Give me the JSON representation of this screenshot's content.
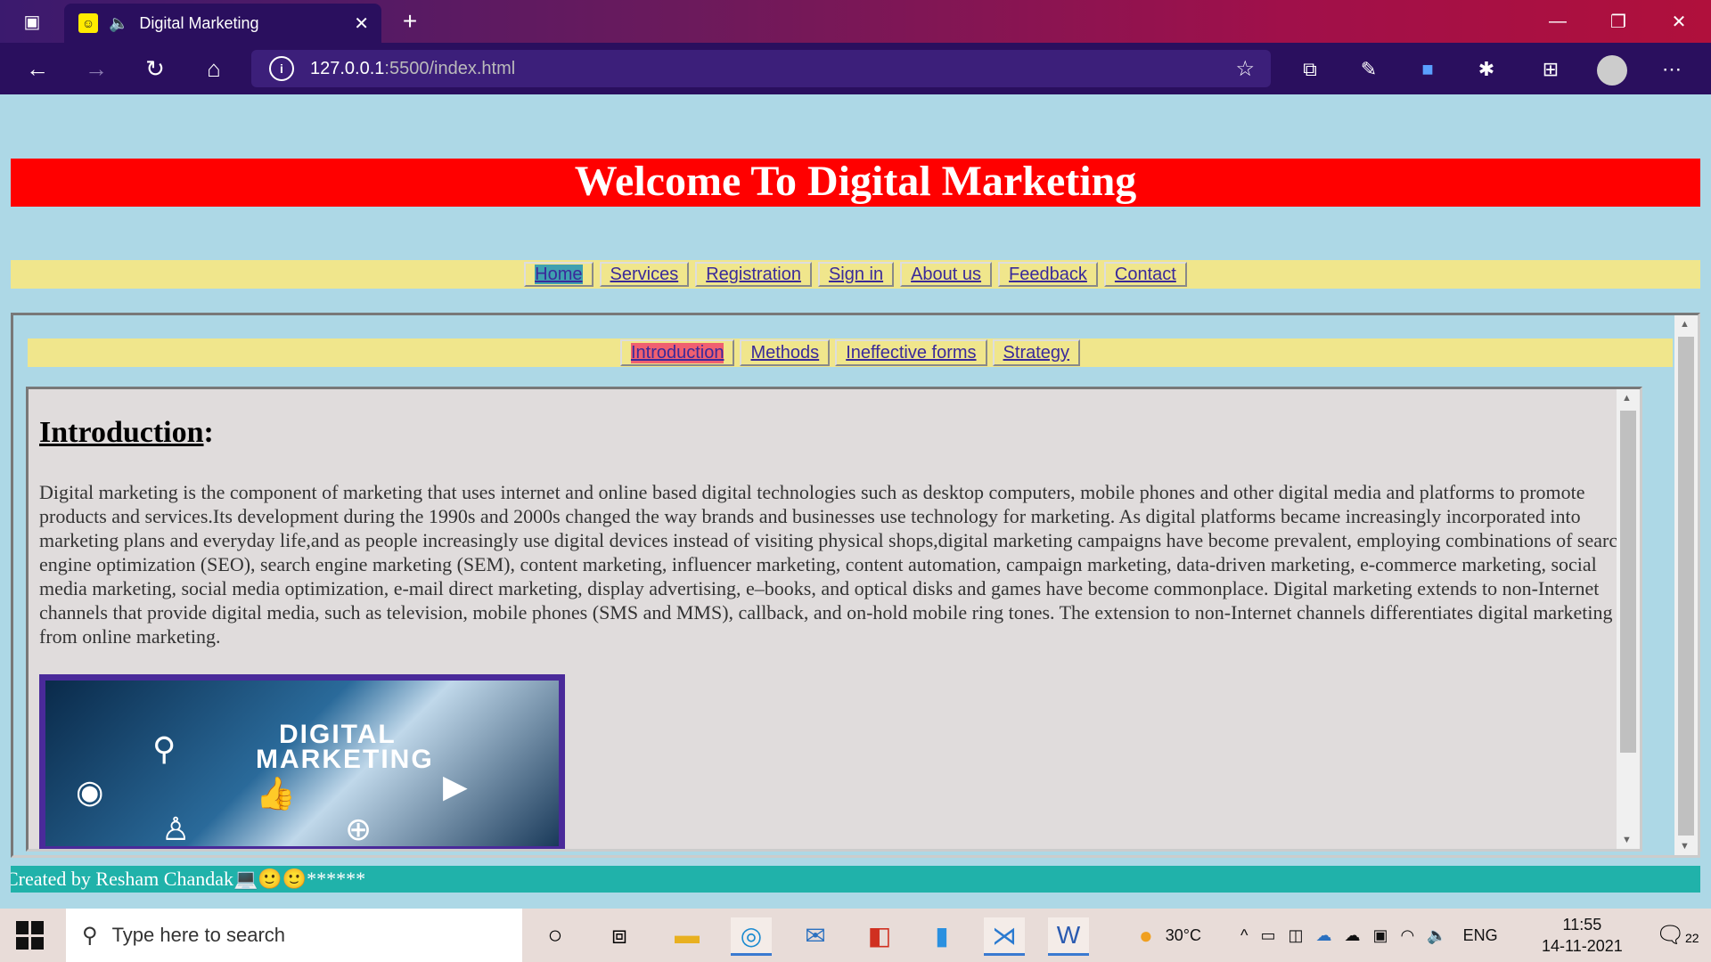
{
  "browser": {
    "tab_title": "Digital Marketing",
    "url_host": "127.0.0.1",
    "url_rest": ":5500/index.html"
  },
  "page": {
    "banner": "Welcome To Digital Marketing",
    "main_nav": [
      "Home",
      "Services",
      "Registration",
      "Sign in",
      "About us",
      "Feedback",
      "Contact"
    ],
    "sub_nav": [
      "Introduction",
      "Methods",
      "Ineffective forms",
      "Strategy"
    ],
    "intro_heading": "Introduction",
    "intro_colon": ":",
    "intro_text": "Digital marketing is the component of marketing that uses internet and online based digital technologies such as desktop computers, mobile phones and other digital media and platforms to promote products and services.Its development during the 1990s and 2000s changed the way brands and businesses use technology for marketing. As digital platforms became increasingly incorporated into marketing plans and everyday life,and as people increasingly use digital devices instead of visiting physical shops,digital marketing campaigns have become prevalent, employing combinations of search engine optimization (SEO), search engine marketing (SEM), content marketing, influencer marketing, content automation, campaign marketing, data-driven marketing, e-commerce marketing, social media marketing, social media optimization, e-mail direct marketing, display advertising, e–books, and optical disks and games have become commonplace. Digital marketing extends to non-Internet channels that provide digital media, such as television, mobile phones (SMS and MMS), callback, and on-hold mobile ring tones. The extension to non-Internet channels differentiates digital marketing from online marketing.",
    "image_line1": "DIGITAL",
    "image_line2": "MARKETING",
    "footer": "Created by Resham Chandak💻🙂🙂******"
  },
  "taskbar": {
    "search_placeholder": "Type here to search",
    "weather": "30°C",
    "language": "ENG",
    "time": "11:55",
    "date": "14-11-2021",
    "notifications": "22"
  }
}
